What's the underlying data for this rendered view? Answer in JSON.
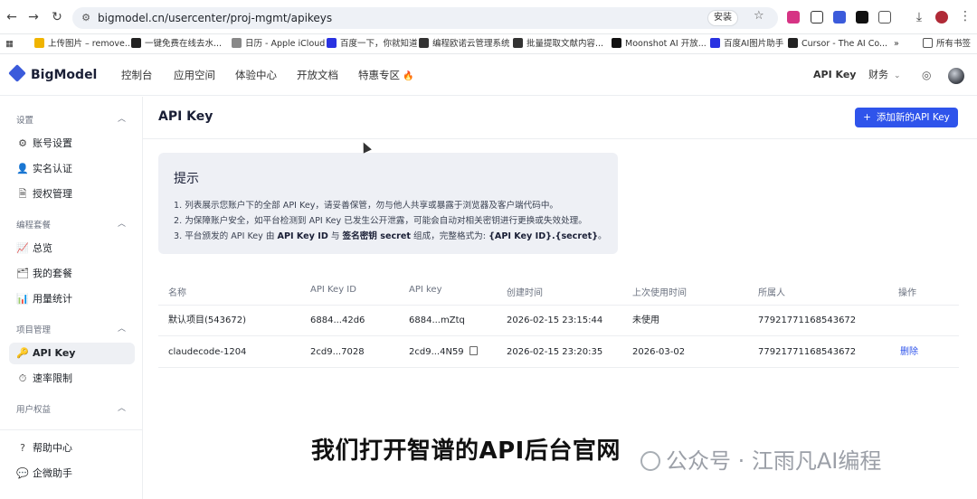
{
  "browser": {
    "url": "bigmodel.cn/usercenter/proj-mgmt/apikeys",
    "install_label": "安装",
    "bookmarks": [
      {
        "label": "上传图片 – remove...",
        "icon_color": "#f0b400"
      },
      {
        "label": "一键免费在线去水...",
        "icon_color": "#222222"
      },
      {
        "label": "日历 - Apple iCloud",
        "icon_color": "#888888"
      },
      {
        "label": "百度一下，你就知道",
        "icon_color": "#2932e1"
      },
      {
        "label": "编程欧诺云管理系统",
        "icon_color": "#333333"
      },
      {
        "label": "批量提取文献内容...",
        "icon_color": "#333333"
      },
      {
        "label": "Moonshot AI 开放...",
        "icon_color": "#111111"
      },
      {
        "label": "百度AI图片助手",
        "icon_color": "#2932e1"
      },
      {
        "label": "Cursor - The AI Co...",
        "icon_color": "#222222"
      }
    ],
    "more_bookmarks": "»",
    "all_bookmarks": "所有书签"
  },
  "header": {
    "brand": "BigModel",
    "nav": [
      "控制台",
      "应用空间",
      "体验中心",
      "开放文档",
      "特惠专区"
    ],
    "hot_icon": "🔥",
    "api_key_label": "API Key",
    "finance_label": "财务",
    "globe_icon": "globe-icon"
  },
  "sidebar": {
    "groups": [
      {
        "title": "设置",
        "items": [
          {
            "label": "账号设置",
            "icon": "⚙"
          },
          {
            "label": "实名认证",
            "icon": "👤"
          },
          {
            "label": "授权管理",
            "icon": "🗎"
          }
        ]
      },
      {
        "title": "编程套餐",
        "items": [
          {
            "label": "总览",
            "icon": "📈"
          },
          {
            "label": "我的套餐",
            "icon": "🗂"
          },
          {
            "label": "用量统计",
            "icon": "📊"
          }
        ]
      },
      {
        "title": "项目管理",
        "items": [
          {
            "label": "API Key",
            "icon": "🔑"
          },
          {
            "label": "速率限制",
            "icon": "⏱"
          }
        ]
      },
      {
        "title": "用户权益",
        "items": []
      }
    ],
    "bottom": [
      {
        "label": "帮助中心",
        "icon": "?"
      },
      {
        "label": "企微助手",
        "icon": "💬"
      }
    ]
  },
  "main": {
    "title": "API Key",
    "add_button": "添加新的API Key",
    "tips": {
      "title": "提示",
      "line1": "1. 列表展示您账户下的全部 API Key，请妥善保管，勿与他人共享或暴露于浏览器及客户端代码中。",
      "line2": "2. 为保障账户安全，如平台检测到 API Key 已发生公开泄露，可能会自动对相关密钥进行更换或失效处理。",
      "line3_a": "3. 平台颁发的 API Key 由 ",
      "line3_b": "API Key ID",
      "line3_c": " 与 ",
      "line3_d": "签名密钥 secret",
      "line3_e": " 组成，完整格式为: ",
      "line3_f": "{API Key ID}.{secret}",
      "line3_g": "。"
    },
    "table": {
      "headers": [
        "名称",
        "API Key ID",
        "API key",
        "创建时间",
        "上次使用时间",
        "所属人",
        "操作"
      ],
      "rows": [
        {
          "name": "默认项目(543672)",
          "id": "6884...42d6",
          "key": "6884...mZtq",
          "created": "2026-02-15 23:15:44",
          "last_used": "未使用",
          "owner": "77921771168543672",
          "action": ""
        },
        {
          "name": "claudecode-1204",
          "id": "2cd9...7028",
          "key": "2cd9...4N59",
          "created": "2026-02-15 23:20:35",
          "last_used": "2026-03-02",
          "owner": "77921771168543672",
          "action": "删除"
        }
      ]
    }
  },
  "caption": "我们打开智谱的API后台官网",
  "watermark": "公众号 · 江雨凡AI编程"
}
